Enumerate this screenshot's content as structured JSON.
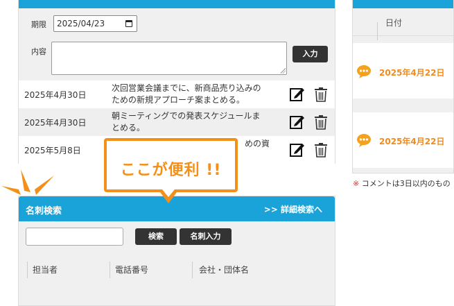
{
  "todo": {
    "deadline_label": "期限",
    "deadline_value": "2025/04/23",
    "content_label": "内容",
    "submit_label": "入力",
    "items": [
      {
        "date": "2025年4月30日",
        "text_line1": "次回営業会議までに、新商品売り込みの",
        "text_line2": "ための新規アプローチ案まとめる。"
      },
      {
        "date": "2025年4月30日",
        "text_line1": "朝ミーティングでの発表スケジュールま",
        "text_line2": "とめる。"
      },
      {
        "date": "2025年5月8日",
        "text_line1": "めの資",
        "text_line2": ""
      }
    ]
  },
  "comments": {
    "date_header": "日付",
    "rows": [
      {
        "date": "2025年4月22日"
      },
      {
        "date": "2025年4月22日"
      }
    ],
    "note_mark": "※",
    "note_text": "コメントは3日以内のもの"
  },
  "callout": {
    "text": "ここが便利 !!"
  },
  "card_search": {
    "title": "名刺検索",
    "advanced_link": ">> 詳細検索へ",
    "search_button": "検索",
    "card_input_button": "名刺入力",
    "columns": [
      "担当者",
      "電話番号",
      "会社・団体名"
    ]
  },
  "colors": {
    "header_blue": "#1aa3d9",
    "accent_orange": "#f39019",
    "button_dark": "#333333",
    "note_red": "#e03030"
  }
}
